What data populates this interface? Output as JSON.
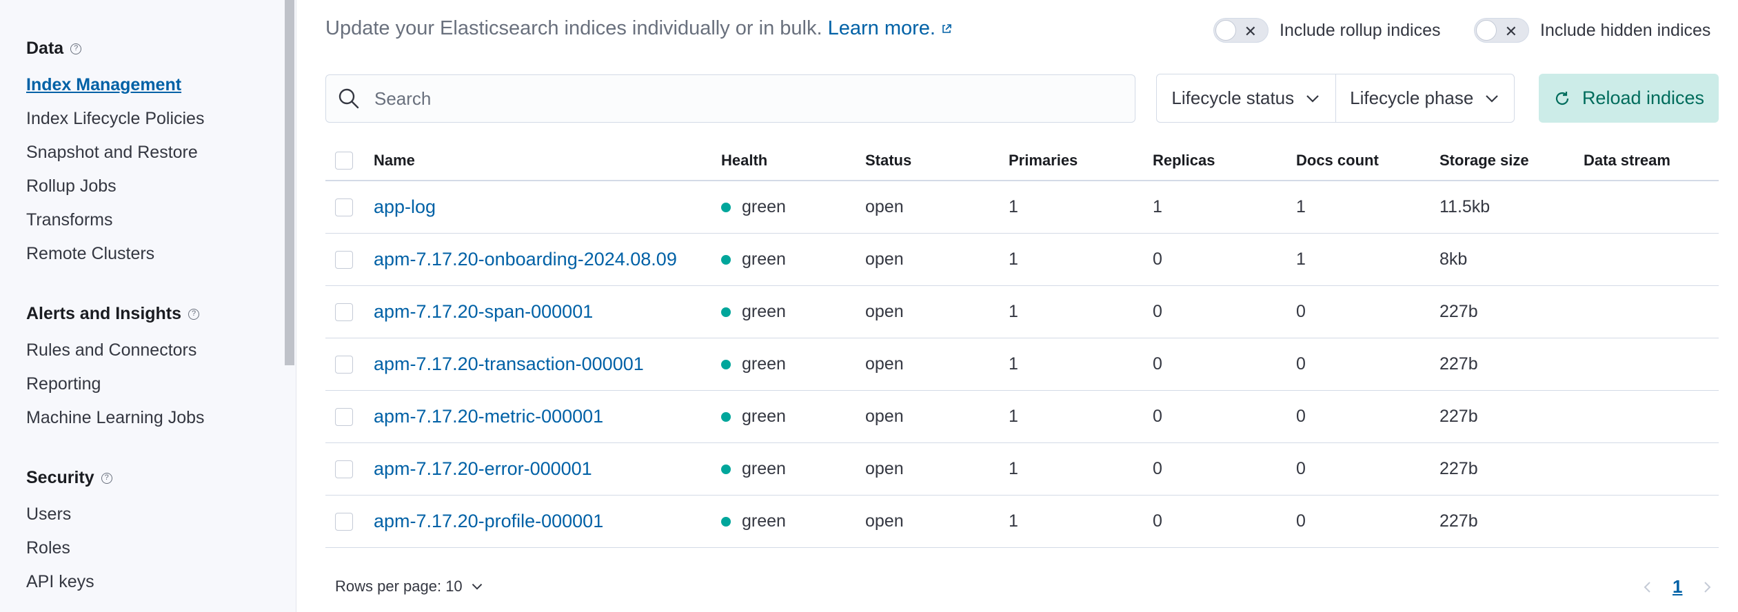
{
  "sidebar": {
    "groups": [
      {
        "title": "Data",
        "items": [
          {
            "label": "Index Management",
            "active": true
          },
          {
            "label": "Index Lifecycle Policies"
          },
          {
            "label": "Snapshot and Restore"
          },
          {
            "label": "Rollup Jobs"
          },
          {
            "label": "Transforms"
          },
          {
            "label": "Remote Clusters"
          }
        ]
      },
      {
        "title": "Alerts and Insights",
        "items": [
          {
            "label": "Rules and Connectors"
          },
          {
            "label": "Reporting"
          },
          {
            "label": "Machine Learning Jobs"
          }
        ]
      },
      {
        "title": "Security",
        "items": [
          {
            "label": "Users"
          },
          {
            "label": "Roles"
          },
          {
            "label": "API keys"
          }
        ]
      }
    ]
  },
  "header": {
    "description": "Update your Elasticsearch indices individually or in bulk.",
    "learn_more": "Learn more.",
    "toggle_rollup": "Include rollup indices",
    "toggle_hidden": "Include hidden indices"
  },
  "toolbar": {
    "search_placeholder": "Search",
    "filter_lifecycle_status": "Lifecycle status",
    "filter_lifecycle_phase": "Lifecycle phase",
    "reload_label": "Reload indices"
  },
  "table": {
    "columns": [
      "Name",
      "Health",
      "Status",
      "Primaries",
      "Replicas",
      "Docs count",
      "Storage size",
      "Data stream"
    ],
    "rows": [
      {
        "name": "app-log",
        "health": "green",
        "status": "open",
        "primaries": "1",
        "replicas": "1",
        "docs": "1",
        "size": "11.5kb",
        "stream": ""
      },
      {
        "name": "apm-7.17.20-onboarding-2024.08.09",
        "health": "green",
        "status": "open",
        "primaries": "1",
        "replicas": "0",
        "docs": "1",
        "size": "8kb",
        "stream": ""
      },
      {
        "name": "apm-7.17.20-span-000001",
        "health": "green",
        "status": "open",
        "primaries": "1",
        "replicas": "0",
        "docs": "0",
        "size": "227b",
        "stream": ""
      },
      {
        "name": "apm-7.17.20-transaction-000001",
        "health": "green",
        "status": "open",
        "primaries": "1",
        "replicas": "0",
        "docs": "0",
        "size": "227b",
        "stream": ""
      },
      {
        "name": "apm-7.17.20-metric-000001",
        "health": "green",
        "status": "open",
        "primaries": "1",
        "replicas": "0",
        "docs": "0",
        "size": "227b",
        "stream": ""
      },
      {
        "name": "apm-7.17.20-error-000001",
        "health": "green",
        "status": "open",
        "primaries": "1",
        "replicas": "0",
        "docs": "0",
        "size": "227b",
        "stream": ""
      },
      {
        "name": "apm-7.17.20-profile-000001",
        "health": "green",
        "status": "open",
        "primaries": "1",
        "replicas": "0",
        "docs": "0",
        "size": "227b",
        "stream": ""
      }
    ]
  },
  "footer": {
    "rows_per_page": "Rows per page: 10",
    "current_page": "1"
  },
  "colors": {
    "link": "#0061a6",
    "health_green": "#00a69b",
    "reload_bg": "#ccece8",
    "reload_text": "#006c5c"
  },
  "icons": [
    "help-icon",
    "external-link-icon",
    "close-icon",
    "search-icon",
    "chevron-down-icon",
    "refresh-icon",
    "chevron-left-icon",
    "chevron-right-icon"
  ]
}
